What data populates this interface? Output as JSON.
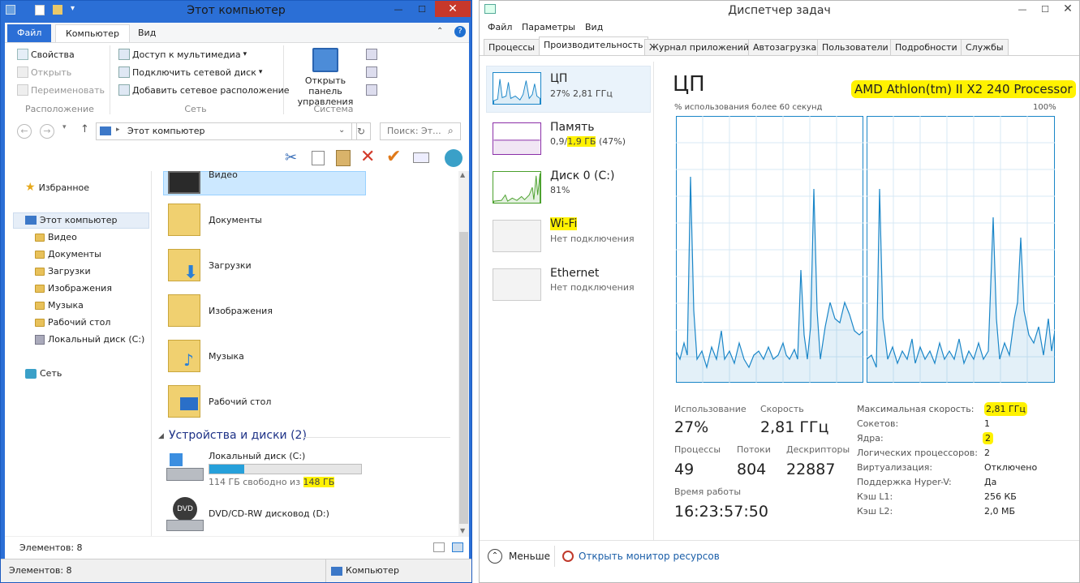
{
  "explorer": {
    "title": "Этот компьютер",
    "tabs": [
      "Файл",
      "Компьютер",
      "Вид"
    ],
    "ribbon": {
      "location": {
        "items": [
          "Свойства",
          "Открыть",
          "Переименовать"
        ],
        "label": "Расположение"
      },
      "network": {
        "items": [
          "Доступ к мультимедиа",
          "Подключить сетевой диск",
          "Добавить сетевое расположение"
        ],
        "label": "Сеть"
      },
      "system": {
        "open_panel": "Открыть панель управления",
        "label": "Система"
      }
    },
    "address": "Этот компьютер",
    "search_placeholder": "Поиск: Эт...",
    "nav": {
      "favorites": "Избранное",
      "this_pc": "Этот компьютер",
      "children": [
        "Видео",
        "Документы",
        "Загрузки",
        "Изображения",
        "Музыка",
        "Рабочий стол",
        "Локальный диск (C:)"
      ],
      "network": "Сеть"
    },
    "folders": [
      "Видео",
      "Документы",
      "Загрузки",
      "Изображения",
      "Музыка",
      "Рабочий стол"
    ],
    "devices_header": "Устройства и диски (2)",
    "disks": [
      {
        "name": "Локальный диск (C:)",
        "free_text": "114 ГБ свободно из ",
        "total": "148 ГБ",
        "used_fraction": 0.23
      },
      {
        "name": "DVD/CD-RW дисковод (D:)"
      }
    ],
    "status_items": "Элементов: 8",
    "bottom_items": "Элементов: 8",
    "bottom_computer": "Компьютер"
  },
  "taskman": {
    "title": "Диспетчер задач",
    "menu": [
      "Файл",
      "Параметры",
      "Вид"
    ],
    "tabs": [
      "Процессы",
      "Производительность",
      "Журнал приложений",
      "Автозагрузка",
      "Пользователи",
      "Подробности",
      "Службы"
    ],
    "resources": [
      {
        "name": "ЦП",
        "sub": "27% 2,81 ГГц"
      },
      {
        "name": "Память",
        "sub_a": "0,9/",
        "sub_b": "1,9 ГБ",
        "sub_c": " (47%)"
      },
      {
        "name": "Диск 0 (C:)",
        "sub": "81%"
      },
      {
        "name": "Wi-Fi",
        "sub": "Нет подключения"
      },
      {
        "name": "Ethernet",
        "sub": "Нет подключения"
      }
    ],
    "cpu_title": "ЦП",
    "cpu_model": "AMD Athlon(tm) II X2 240 Processor",
    "graph_label": "% использования более 60 секунд",
    "graph_max": "100%",
    "stats": {
      "usage_lbl": "Использование",
      "usage_val": "27%",
      "speed_lbl": "Скорость",
      "speed_val": "2,81 ГГц",
      "proc_lbl": "Процессы",
      "proc_val": "49",
      "threads_lbl": "Потоки",
      "threads_val": "804",
      "handles_lbl": "Дескрипторы",
      "handles_val": "22887",
      "uptime_lbl": "Время работы",
      "uptime_val": "16:23:57:50"
    },
    "details": [
      {
        "k": "Максимальная скорость:",
        "v": "2,81 ГГц"
      },
      {
        "k": "Сокетов:",
        "v": "1"
      },
      {
        "k": "Ядра:",
        "v": "2"
      },
      {
        "k": "Логических процессоров:",
        "v": "2"
      },
      {
        "k": "Виртуализация:",
        "v": "Отключено"
      },
      {
        "k": "Поддержка Hyper-V:",
        "v": "Да"
      },
      {
        "k": "Кэш L1:",
        "v": "256 КБ"
      },
      {
        "k": "Кэш L2:",
        "v": "2,0 МБ"
      }
    ],
    "less": "Меньше",
    "open_monitor": "Открыть монитор ресурсов",
    "colors": {
      "accent": "#1a86c8",
      "memory": "#8b2fa8",
      "disk": "#4aa02c",
      "highlight": "#fff200"
    }
  }
}
